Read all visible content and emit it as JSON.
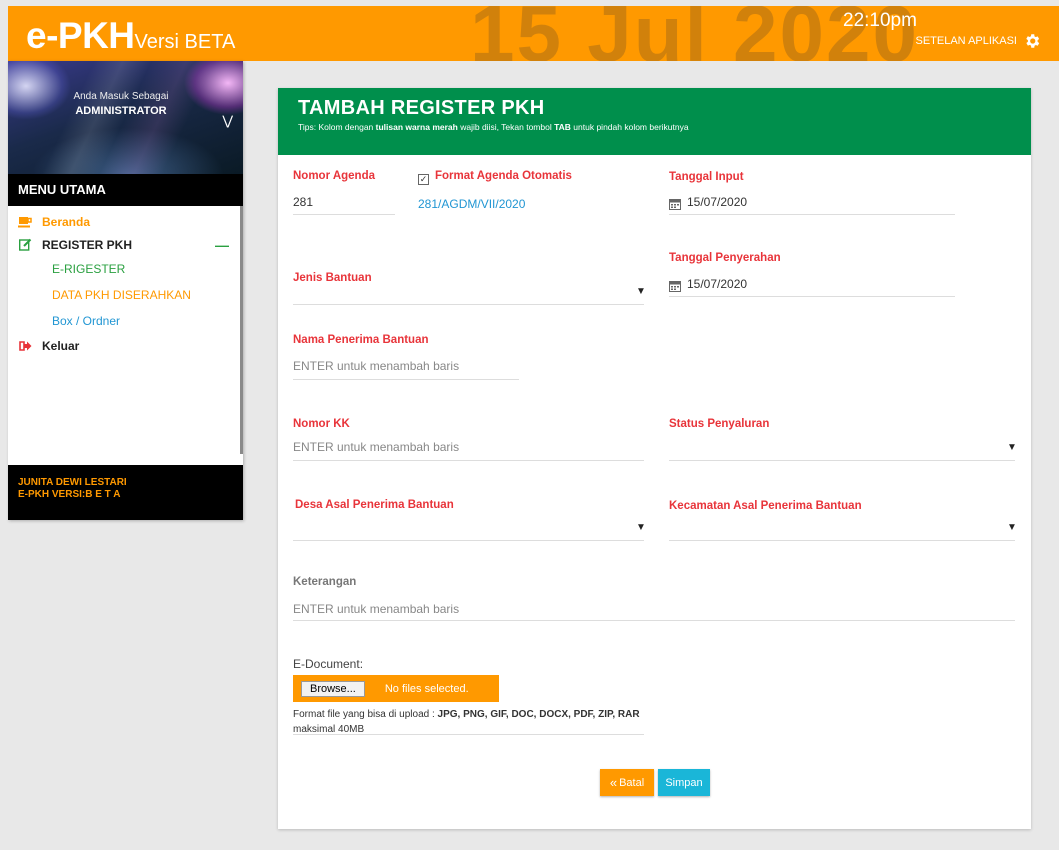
{
  "header": {
    "brand_main": "e-PKH",
    "brand_sub": "Versi BETA",
    "date_big": "15 Jul 2020",
    "time": "22:10pm",
    "settings_label": "SETELAN APLIKASI",
    "colors": {
      "bar": "#ff9900"
    }
  },
  "sidebar": {
    "profile_sub": "Anda Masuk Sebagai",
    "profile_role": "ADMINISTRATOR",
    "menu_title": "MENU UTAMA",
    "items": [
      {
        "label": "Beranda",
        "icon": "coffee-cup-icon"
      },
      {
        "label": "REGISTER PKH",
        "icon": "edit-icon"
      },
      {
        "label": "Keluar",
        "icon": "sign-out-icon"
      }
    ],
    "subitems": [
      {
        "label": "E-RIGESTER"
      },
      {
        "label": "DATA PKH DISERAHKAN"
      },
      {
        "label": "Box / Ordner"
      }
    ],
    "footer_name": "JUNITA DEWI LESTARI",
    "footer_version": "E-PKH VERSI:B E T A"
  },
  "form": {
    "title": "TAMBAH REGISTER PKH",
    "tips_pre": "Tips: Kolom dengan ",
    "tips_bold": "tulisan warna merah",
    "tips_mid": " wajib diisi, Tekan tombol ",
    "tips_tab": "TAB",
    "tips_post": " untuk pindah kolom berikutnya",
    "nomor_agenda_label": "Nomor Agenda",
    "nomor_agenda_value": "281",
    "format_otomatis_label": "Format Agenda Otomatis",
    "format_otomatis_value": "281/AGDM/VII/2020",
    "tanggal_input_label": "Tanggal Input",
    "tanggal_input_value": "15/07/2020",
    "tanggal_penyerahan_label": "Tanggal Penyerahan",
    "tanggal_penyerahan_value": "15/07/2020",
    "jenis_bantuan_label": "Jenis Bantuan",
    "nama_penerima_label": "Nama Penerima Bantuan",
    "nama_penerima_placeholder": "ENTER untuk menambah baris",
    "nomor_kk_label": "Nomor KK",
    "nomor_kk_placeholder": "ENTER untuk menambah baris",
    "status_penyaluran_label": "Status Penyaluran",
    "desa_label": "Desa Asal Penerima Bantuan",
    "kecamatan_label": "Kecamatan Asal Penerima Bantuan",
    "keterangan_label": "Keterangan",
    "keterangan_placeholder": "ENTER untuk menambah baris",
    "edoc_label": "E-Document:",
    "browse_label": "Browse...",
    "nofile_label": "No files selected.",
    "format_pre": "Format file yang bisa di upload : ",
    "format_types": "JPG, PNG, GIF, DOC, DOCX, PDF, ZIP, RAR",
    "format_max": "maksimal 40MB",
    "batal_label": "Batal",
    "simpan_label": "Simpan",
    "colors": {
      "header": "#008f4c",
      "required": "#e8343a",
      "link": "#2196d3"
    }
  }
}
